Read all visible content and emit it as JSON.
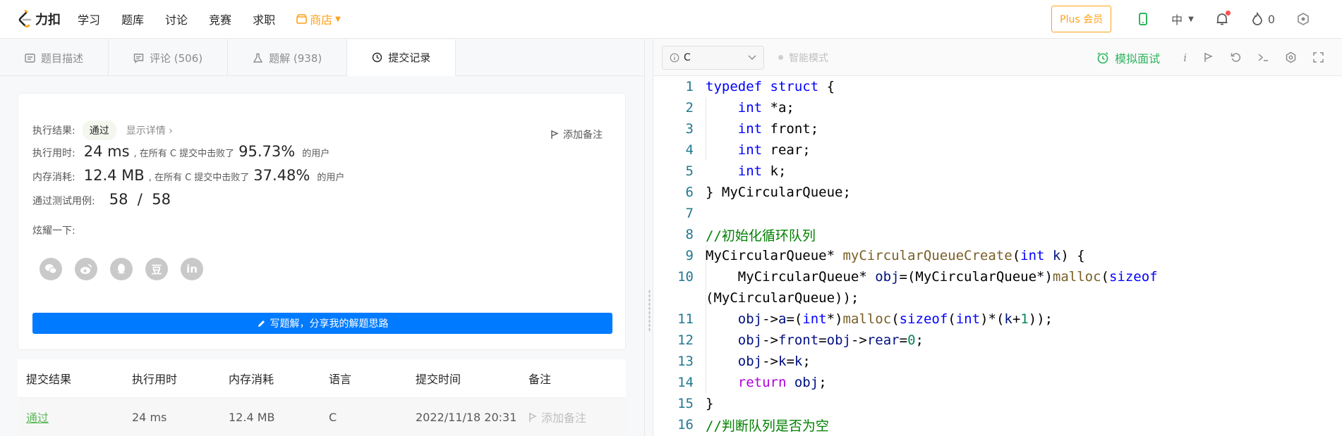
{
  "nav": {
    "logo_text": "力扣",
    "items": [
      "学习",
      "题库",
      "讨论",
      "竞赛",
      "求职"
    ],
    "shop_label": "商店",
    "plus_label": "Plus 会员",
    "lang_label": "中",
    "fire_count": "0"
  },
  "tabs": [
    {
      "label": "题目描述"
    },
    {
      "label": "评论 (506)"
    },
    {
      "label": "题解 (938)"
    },
    {
      "label": "提交记录"
    }
  ],
  "result": {
    "label_result": "执行结果:",
    "status": "通过",
    "detail_link": "显示详情 ›",
    "add_note": "添加备注",
    "label_time": "执行用时:",
    "time_value": "24 ms",
    "time_text": ", 在所有 C 提交中击败了",
    "time_pct": "95.73%",
    "users_text": "的用户",
    "label_mem": "内存消耗:",
    "mem_value": "12.4 MB",
    "mem_text": ", 在所有 C 提交中击败了",
    "mem_pct": "37.48%",
    "label_cases": "通过测试用例:",
    "cases_value": "58  /  58",
    "label_share": "炫耀一下:",
    "share_icons": [
      "wechat-icon",
      "weibo-icon",
      "qq-icon",
      "douban-icon",
      "linkedin-icon"
    ],
    "share_glyphs": [
      "",
      "",
      "",
      "豆",
      "in"
    ],
    "write_btn": "写题解，分享我的解题思路"
  },
  "table": {
    "headers": [
      "提交结果",
      "执行用时",
      "内存消耗",
      "语言",
      "提交时间",
      "备注"
    ],
    "rows": [
      {
        "status": "通过",
        "time": "24 ms",
        "memory": "12.4 MB",
        "lang": "C",
        "submitted": "2022/11/18 20:31",
        "note": "添加备注"
      }
    ]
  },
  "editor": {
    "language": "C",
    "smart_mode": "智能模式",
    "mock_interview": "模拟面试"
  },
  "colors": {
    "accent_orange": "#ffa116",
    "primary_blue": "#007aff",
    "success_green": "#2db55d"
  }
}
